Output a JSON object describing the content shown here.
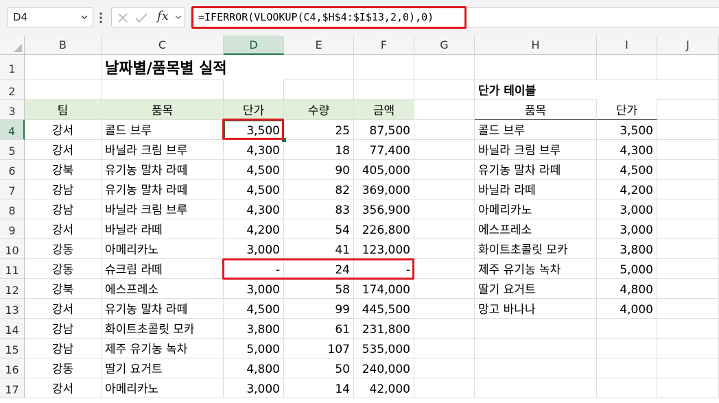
{
  "name_box": {
    "value": "D4"
  },
  "formula_bar": {
    "fx_label": "fx",
    "formula": "=IFERROR(VLOOKUP(C4,$H$4:$I$13,2,0),0)"
  },
  "columns": [
    "B",
    "C",
    "D",
    "E",
    "F",
    "G",
    "H",
    "I",
    "J"
  ],
  "rows": [
    "1",
    "2",
    "3",
    "4",
    "5",
    "6",
    "7",
    "8",
    "9",
    "10",
    "11",
    "12",
    "13",
    "14",
    "15",
    "16",
    "17"
  ],
  "sheet": {
    "title": "날짜별/품목별 실적",
    "headers": [
      "팀",
      "품목",
      "단가",
      "수량",
      "금액"
    ],
    "data": [
      [
        "강서",
        "콜드 브루",
        "3,500",
        "25",
        "87,500"
      ],
      [
        "강서",
        "바닐라 크림 브루",
        "4,300",
        "18",
        "77,400"
      ],
      [
        "강북",
        "유기농 말차 라떼",
        "4,500",
        "90",
        "405,000"
      ],
      [
        "강남",
        "유기농 말차 라떼",
        "4,500",
        "82",
        "369,000"
      ],
      [
        "강남",
        "바닐라 크림 브루",
        "4,300",
        "83",
        "356,900"
      ],
      [
        "강서",
        "바닐라 라떼",
        "4,200",
        "54",
        "226,800"
      ],
      [
        "강동",
        "아메리카노",
        "3,000",
        "41",
        "123,000"
      ],
      [
        "강동",
        "슈크림 라떼",
        "-",
        "24",
        "-"
      ],
      [
        "강북",
        "에스프레소",
        "3,000",
        "58",
        "174,000"
      ],
      [
        "강서",
        "유기농 말차 라떼",
        "4,500",
        "99",
        "445,500"
      ],
      [
        "강남",
        "화이트초콜릿 모카",
        "3,800",
        "61",
        "231,800"
      ],
      [
        "강남",
        "제주 유기농 녹차",
        "5,000",
        "107",
        "535,000"
      ],
      [
        "강동",
        "딸기 요거트",
        "4,800",
        "50",
        "240,000"
      ],
      [
        "강서",
        "아메리카노",
        "3,000",
        "14",
        "42,000"
      ]
    ]
  },
  "price_table": {
    "title": "단가 테이블",
    "headers": [
      "품목",
      "단가"
    ],
    "items": [
      [
        "콜드 브루",
        "3,500"
      ],
      [
        "바닐라 크림 브루",
        "4,300"
      ],
      [
        "유기농 말차 라떼",
        "4,500"
      ],
      [
        "바닐라 라떼",
        "4,200"
      ],
      [
        "아메리카노",
        "3,000"
      ],
      [
        "에스프레소",
        "3,000"
      ],
      [
        "화이트초콜릿 모카",
        "3,800"
      ],
      [
        "제주 유기농 녹차",
        "5,000"
      ],
      [
        "딸기 요거트",
        "4,800"
      ],
      [
        "망고 바나나",
        "4,000"
      ]
    ]
  },
  "colors": {
    "selection": "#217346",
    "highlight": "#e0161d",
    "header_fill": "#e2efda"
  }
}
